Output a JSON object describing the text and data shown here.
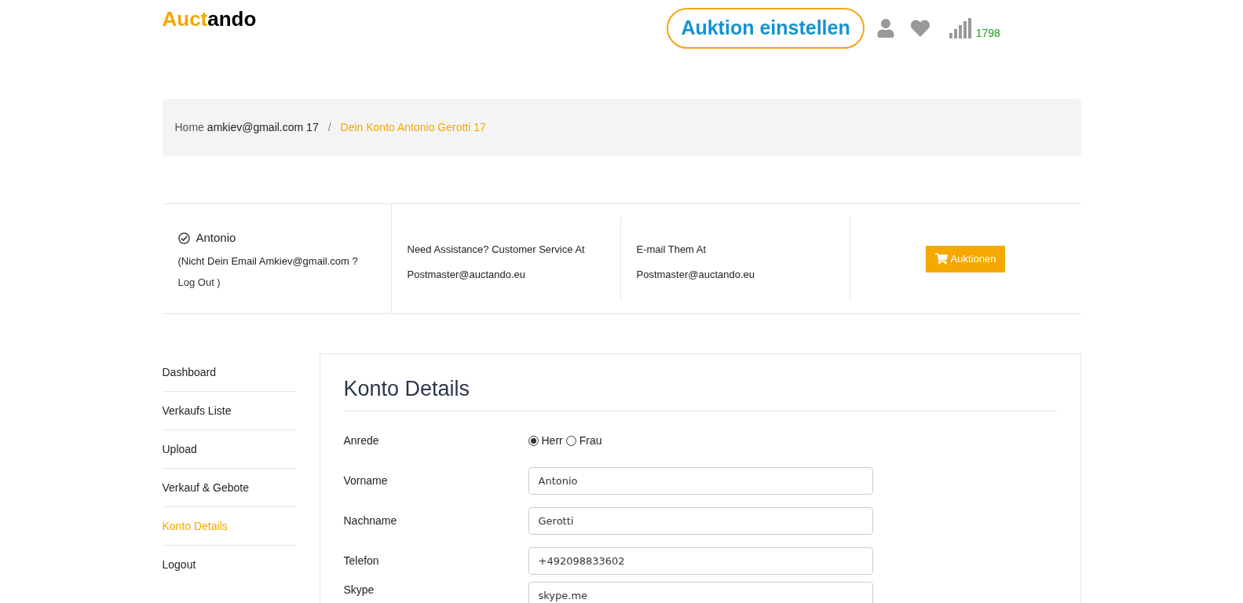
{
  "logo": {
    "accent": "Auct",
    "rest": "ando"
  },
  "header": {
    "cta": "Auktion einstellen",
    "counter": "1798"
  },
  "breadcrumb": [
    {
      "label": "Home",
      "kind": "link"
    },
    {
      "label": "amkiev@gmail.com 17",
      "kind": "text"
    },
    {
      "label": "Dein Konto Antonio Gerotti 17",
      "kind": "current"
    }
  ],
  "breadcrumb_separator": "/",
  "account": {
    "name": "Antonio",
    "note": "(Nicht Dein Email Amkiev@gmail.com ?",
    "logout": "Log Out )"
  },
  "info": [
    {
      "line1": "Need Assistance? Customer Service At",
      "line2": "Postmaster@auctando.eu"
    },
    {
      "line1": "E-mail Them At",
      "line2": "Postmaster@auctando.eu"
    }
  ],
  "auctions_button": "Auktionen",
  "sidebar": [
    {
      "label": "Dashboard",
      "selected": false
    },
    {
      "label": "Verkaufs Liste",
      "selected": false
    },
    {
      "label": "Upload",
      "selected": false
    },
    {
      "label": "Verkauf & Gebote",
      "selected": false
    },
    {
      "label": "Konto Details",
      "selected": true
    },
    {
      "label": "Logout",
      "selected": false
    }
  ],
  "form": {
    "title": "Konto Details",
    "fields": [
      {
        "kind": "radio",
        "label": "Anrede",
        "options": [
          {
            "label": "Herr",
            "selected": true
          },
          {
            "label": "Frau",
            "selected": false
          }
        ]
      },
      {
        "kind": "text",
        "label": "Vorname",
        "value": "Antonio"
      },
      {
        "kind": "text",
        "label": "Nachname",
        "value": "Gerotti"
      },
      {
        "kind": "text",
        "label": "Telefon",
        "value": "+492098833602"
      },
      {
        "kind": "text",
        "label": "Skype",
        "value": "skype.me"
      }
    ]
  }
}
